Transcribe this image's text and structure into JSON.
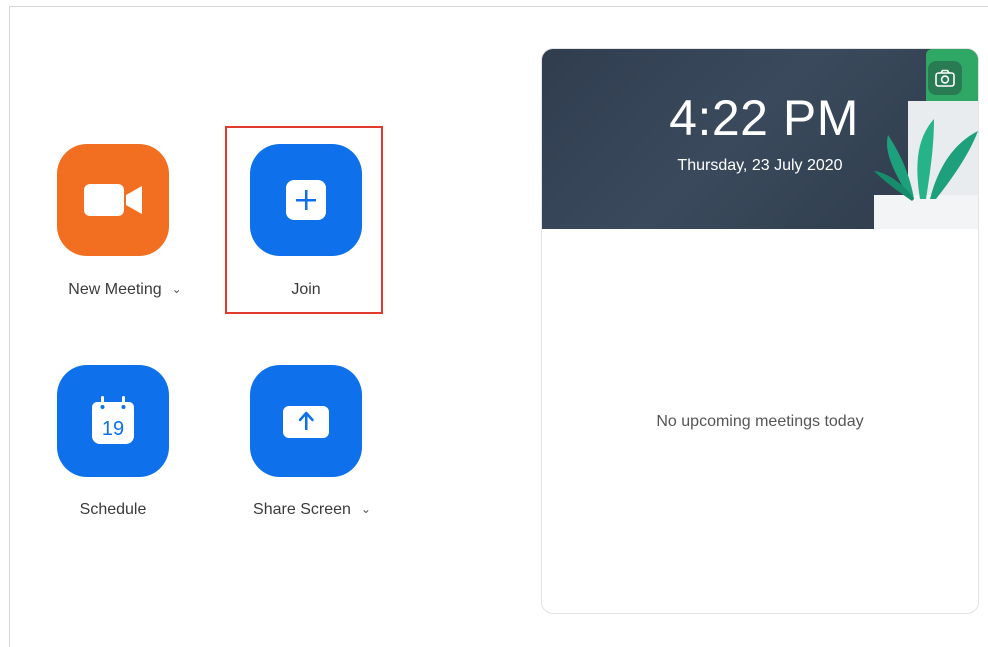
{
  "actions": {
    "new_meeting": {
      "label": "New Meeting",
      "icon": "video-camera-icon",
      "color": "#f26f21"
    },
    "join": {
      "label": "Join",
      "icon": "plus-icon",
      "color": "#0e71eb"
    },
    "schedule": {
      "label": "Schedule",
      "icon": "calendar-icon",
      "calendar_day": "19",
      "color": "#0e71eb"
    },
    "share_screen": {
      "label": "Share Screen",
      "icon": "upload-arrow-icon",
      "color": "#0e71eb"
    }
  },
  "chevron": "⌄",
  "highlight_color": "#e03a2f",
  "clock": {
    "time": "4:22 PM",
    "date": "Thursday, 23 July 2020"
  },
  "meetings": {
    "empty_text": "No upcoming meetings today"
  }
}
